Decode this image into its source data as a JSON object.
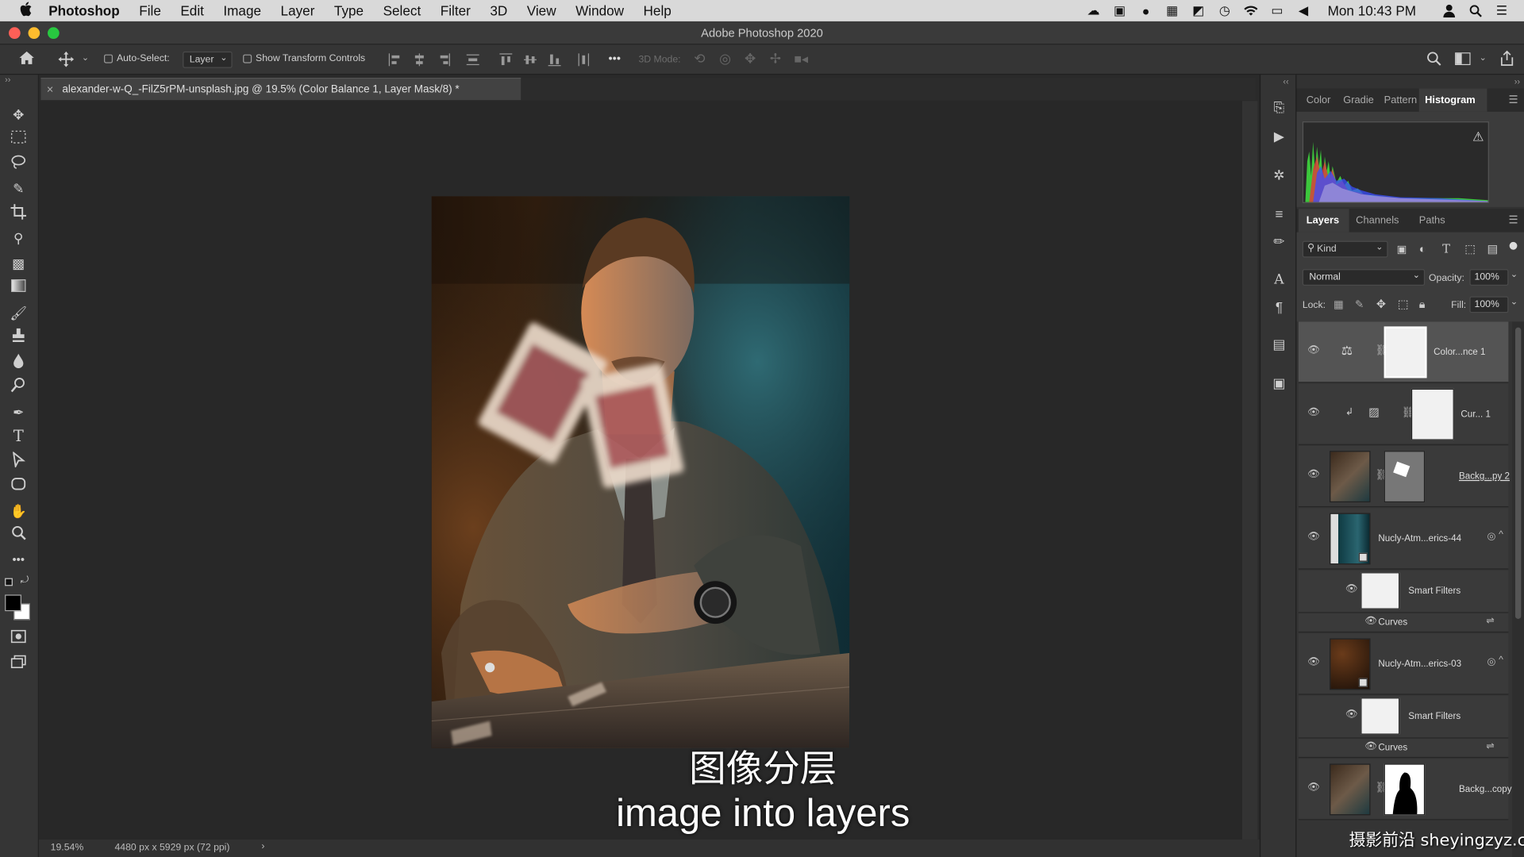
{
  "menubar": {
    "apple": "",
    "app": "Photoshop",
    "items": [
      "File",
      "Edit",
      "Image",
      "Layer",
      "Type",
      "Select",
      "Filter",
      "3D",
      "View",
      "Window",
      "Help"
    ],
    "clock": "Mon 10:43 PM"
  },
  "window": {
    "title": "Adobe Photoshop 2020"
  },
  "options": {
    "auto_select_label": "Auto-Select:",
    "auto_select_value": "Layer",
    "transform_label": "Show Transform Controls",
    "mode_3d": "3D Mode:",
    "more": "•••"
  },
  "document": {
    "tab_title": "alexander-w-Q_-FilZ5rPM-unsplash.jpg @ 19.5% (Color Balance 1, Layer Mask/8) *",
    "close": "×"
  },
  "status": {
    "zoom": "19.54%",
    "info": "4480 px x 5929 px (72 ppi)",
    "arrow": "›"
  },
  "top_panel": {
    "tabs": [
      "Color",
      "Gradie",
      "Pattern",
      "Histogram"
    ],
    "active": "Histogram",
    "warning": "⚠"
  },
  "layers_panel": {
    "tabs": [
      "Layers",
      "Channels",
      "Paths"
    ],
    "kind": "Kind",
    "blend_mode": "Normal",
    "opacity_label": "Opacity:",
    "opacity_value": "100%",
    "lock_label": "Lock:",
    "fill_label": "Fill:",
    "fill_value": "100%",
    "layers": [
      {
        "name": "Color...nce 1"
      },
      {
        "name": "Cur... 1"
      },
      {
        "name": "Backg...py 2"
      },
      {
        "name": "Nucly-Atm...erics-44"
      },
      {
        "name": "Smart Filters"
      },
      {
        "name": "Curves"
      },
      {
        "name": "Nucly-Atm...erics-03"
      },
      {
        "name": "Smart Filters"
      },
      {
        "name": "Curves"
      },
      {
        "name": "Backg...copy"
      }
    ]
  },
  "captions": {
    "chinese": "图像分层",
    "english": "image into layers"
  },
  "watermark": "摄影前沿 sheyingzyz.com"
}
